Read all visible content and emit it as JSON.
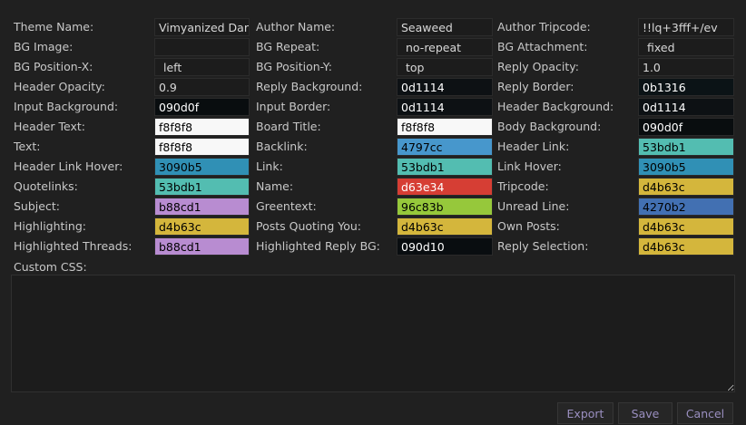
{
  "columns": [
    [
      {
        "label": "Theme Name:",
        "value": "Vimyanized Dark",
        "kind": "text"
      },
      {
        "label": "BG Image:",
        "value": "",
        "kind": "text"
      },
      {
        "label": "BG Position-X:",
        "value": "left",
        "kind": "text",
        "indent": true
      },
      {
        "label": "Header Opacity:",
        "value": "0.9",
        "kind": "text"
      },
      {
        "label": "Input Background:",
        "value": "090d0f",
        "kind": "color",
        "bg": "#090d0f",
        "fg": "#ffffff"
      },
      {
        "label": "Header Text:",
        "value": "f8f8f8",
        "kind": "color",
        "bg": "#f8f8f8",
        "fg": "#000000"
      },
      {
        "label": "Text:",
        "value": "f8f8f8",
        "kind": "color",
        "bg": "#f8f8f8",
        "fg": "#000000"
      },
      {
        "label": "Header Link Hover:",
        "value": "3090b5",
        "kind": "color",
        "bg": "#3090b5",
        "fg": "#000000"
      },
      {
        "label": "Quotelinks:",
        "value": "53bdb1",
        "kind": "color",
        "bg": "#53bdb1",
        "fg": "#000000"
      },
      {
        "label": "Subject:",
        "value": "b88cd1",
        "kind": "color",
        "bg": "#b88cd1",
        "fg": "#000000"
      },
      {
        "label": "Highlighting:",
        "value": "d4b63c",
        "kind": "color",
        "bg": "#d4b63c",
        "fg": "#000000"
      },
      {
        "label": "Highlighted Threads:",
        "value": "b88cd1",
        "kind": "color",
        "bg": "#b88cd1",
        "fg": "#000000"
      }
    ],
    [
      {
        "label": "Author Name:",
        "value": "Seaweed",
        "kind": "text"
      },
      {
        "label": "BG Repeat:",
        "value": "no-repeat",
        "kind": "text",
        "indent": true
      },
      {
        "label": "BG Position-Y:",
        "value": "top",
        "kind": "text",
        "indent": true
      },
      {
        "label": "Reply Background:",
        "value": "0d1114",
        "kind": "color",
        "bg": "#0d1114",
        "fg": "#ffffff"
      },
      {
        "label": "Input Border:",
        "value": "0d1114",
        "kind": "color",
        "bg": "#0d1114",
        "fg": "#ffffff"
      },
      {
        "label": "Board Title:",
        "value": "f8f8f8",
        "kind": "color",
        "bg": "#f8f8f8",
        "fg": "#000000"
      },
      {
        "label": "Backlink:",
        "value": "4797cc",
        "kind": "color",
        "bg": "#4797cc",
        "fg": "#000000"
      },
      {
        "label": "Link:",
        "value": "53bdb1",
        "kind": "color",
        "bg": "#53bdb1",
        "fg": "#000000"
      },
      {
        "label": "Name:",
        "value": "d63e34",
        "kind": "color",
        "bg": "#d63e34",
        "fg": "#ffffff"
      },
      {
        "label": "Greentext:",
        "value": "96c83b",
        "kind": "color",
        "bg": "#96c83b",
        "fg": "#000000"
      },
      {
        "label": "Posts Quoting You:",
        "value": "d4b63c",
        "kind": "color",
        "bg": "#d4b63c",
        "fg": "#000000"
      },
      {
        "label": "Highlighted Reply BG:",
        "value": "090d10",
        "kind": "color",
        "bg": "#090d10",
        "fg": "#ffffff"
      }
    ],
    [
      {
        "label": "Author Tripcode:",
        "value": "!!lq+3fff+/ev",
        "kind": "text"
      },
      {
        "label": "BG Attachment:",
        "value": "fixed",
        "kind": "text",
        "indent": true
      },
      {
        "label": "Reply Opacity:",
        "value": "1.0",
        "kind": "text"
      },
      {
        "label": "Reply Border:",
        "value": "0b1316",
        "kind": "color",
        "bg": "#0b1316",
        "fg": "#ffffff"
      },
      {
        "label": "Header Background:",
        "value": "0d1114",
        "kind": "color",
        "bg": "#0d1114",
        "fg": "#ffffff"
      },
      {
        "label": "Body Background:",
        "value": "090d0f",
        "kind": "color",
        "bg": "#090d0f",
        "fg": "#ffffff"
      },
      {
        "label": "Header Link:",
        "value": "53bdb1",
        "kind": "color",
        "bg": "#53bdb1",
        "fg": "#000000"
      },
      {
        "label": "Link Hover:",
        "value": "3090b5",
        "kind": "color",
        "bg": "#3090b5",
        "fg": "#000000"
      },
      {
        "label": "Tripcode:",
        "value": "d4b63c",
        "kind": "color",
        "bg": "#d4b63c",
        "fg": "#000000"
      },
      {
        "label": "Unread Line:",
        "value": "4270b2",
        "kind": "color",
        "bg": "#4270b2",
        "fg": "#000000"
      },
      {
        "label": "Own Posts:",
        "value": "d4b63c",
        "kind": "color",
        "bg": "#d4b63c",
        "fg": "#000000"
      },
      {
        "label": "Reply Selection:",
        "value": "d4b63c",
        "kind": "color",
        "bg": "#d4b63c",
        "fg": "#000000"
      }
    ]
  ],
  "custom_css": {
    "label": "Custom CSS:",
    "value": ""
  },
  "buttons": {
    "export": "Export",
    "save": "Save",
    "cancel": "Cancel"
  }
}
